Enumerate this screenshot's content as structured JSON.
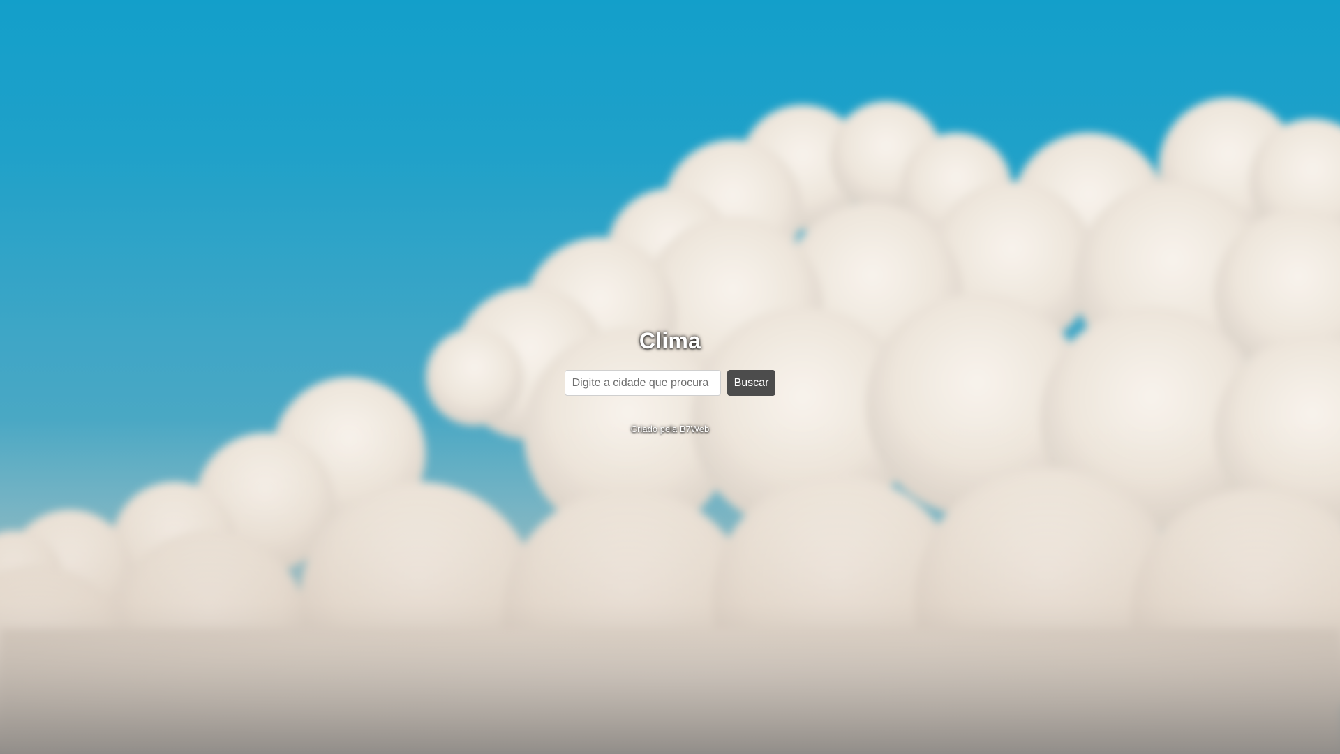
{
  "page": {
    "title": "Clima",
    "background": "sky-with-clouds-photo"
  },
  "search": {
    "placeholder": "Digite a cidade que procura",
    "value": "",
    "button_label": "Buscar"
  },
  "footer": {
    "credit": "Criado pela B7Web"
  },
  "colors": {
    "sky": "#139fca",
    "button": "#4c4c4c",
    "text": "#ffffff"
  }
}
